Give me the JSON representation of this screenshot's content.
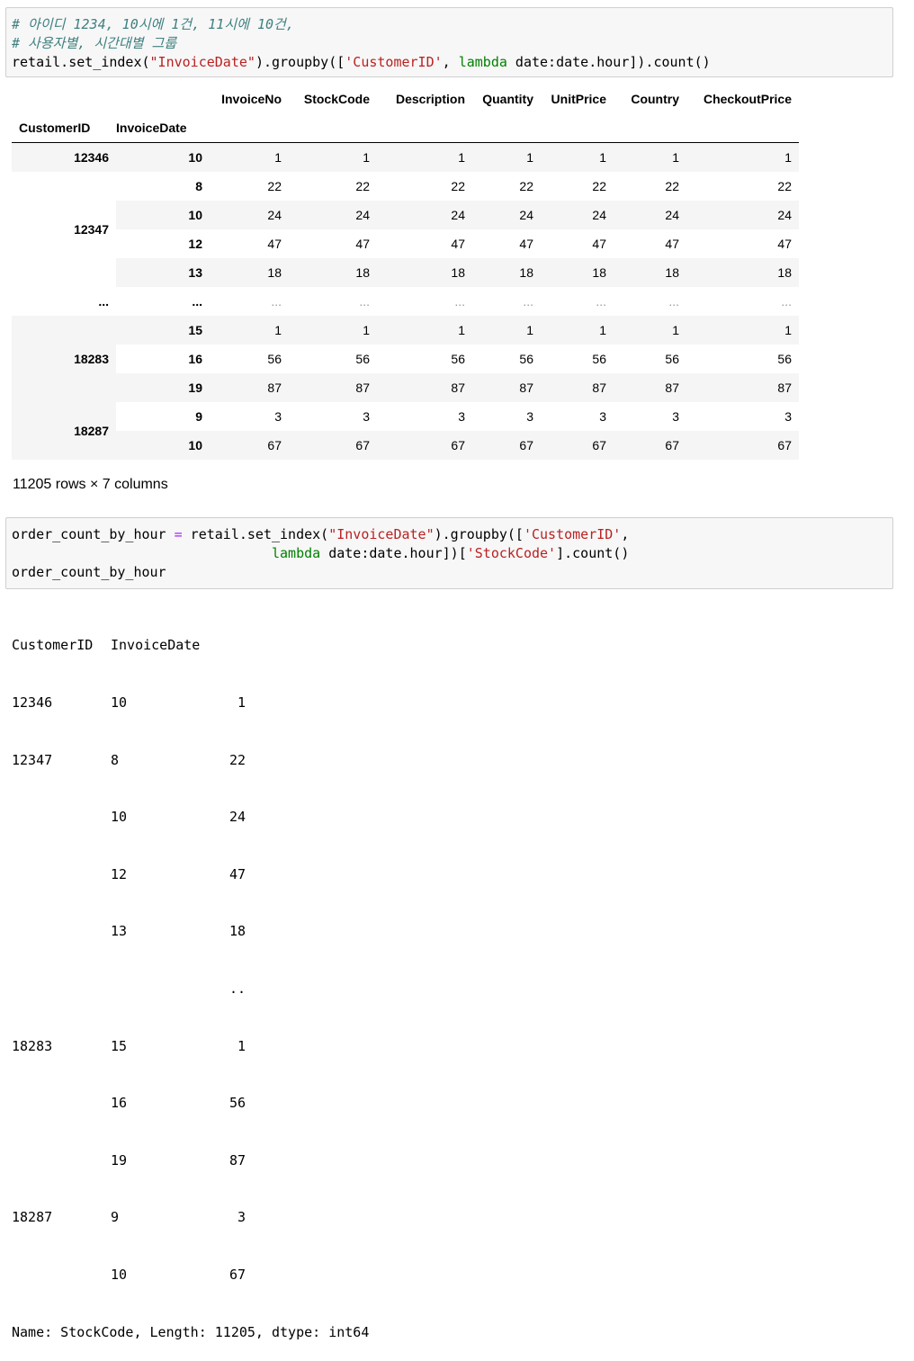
{
  "cell1": {
    "comment1": "# 아이디 1234, 10시에 1건, 11시에 10건,",
    "comment2": "# 사용자별, 시간대별 그룹",
    "code_a": "retail.set_index(",
    "code_str1": "\"InvoiceDate\"",
    "code_b": ").groupby([",
    "code_str2": "'CustomerID'",
    "code_c": ", ",
    "code_kw": "lambda",
    "code_d": " date:date.hour]).count()"
  },
  "dataframe": {
    "columns": [
      "InvoiceNo",
      "StockCode",
      "Description",
      "Quantity",
      "UnitPrice",
      "Country",
      "CheckoutPrice"
    ],
    "index_names": [
      "CustomerID",
      "InvoiceDate"
    ],
    "groups": [
      {
        "customer": "12346",
        "rows": [
          {
            "hour": "10",
            "values": [
              "1",
              "1",
              "1",
              "1",
              "1",
              "1",
              "1"
            ]
          }
        ]
      },
      {
        "customer": "12347",
        "rows": [
          {
            "hour": "8",
            "values": [
              "22",
              "22",
              "22",
              "22",
              "22",
              "22",
              "22"
            ]
          },
          {
            "hour": "10",
            "values": [
              "24",
              "24",
              "24",
              "24",
              "24",
              "24",
              "24"
            ]
          },
          {
            "hour": "12",
            "values": [
              "47",
              "47",
              "47",
              "47",
              "47",
              "47",
              "47"
            ]
          },
          {
            "hour": "13",
            "values": [
              "18",
              "18",
              "18",
              "18",
              "18",
              "18",
              "18"
            ]
          }
        ]
      },
      {
        "customer": "...",
        "rows": [
          {
            "hour": "...",
            "values": [
              "...",
              "...",
              "...",
              "...",
              "...",
              "...",
              "..."
            ]
          }
        ]
      },
      {
        "customer": "18283",
        "rows": [
          {
            "hour": "15",
            "values": [
              "1",
              "1",
              "1",
              "1",
              "1",
              "1",
              "1"
            ]
          },
          {
            "hour": "16",
            "values": [
              "56",
              "56",
              "56",
              "56",
              "56",
              "56",
              "56"
            ]
          },
          {
            "hour": "19",
            "values": [
              "87",
              "87",
              "87",
              "87",
              "87",
              "87",
              "87"
            ]
          }
        ]
      },
      {
        "customer": "18287",
        "rows": [
          {
            "hour": "9",
            "values": [
              "3",
              "3",
              "3",
              "3",
              "3",
              "3",
              "3"
            ]
          },
          {
            "hour": "10",
            "values": [
              "67",
              "67",
              "67",
              "67",
              "67",
              "67",
              "67"
            ]
          }
        ]
      }
    ],
    "shape_note": "11205 rows × 7 columns"
  },
  "cell2": {
    "l1_a": "order_count_by_hour ",
    "l1_op": "=",
    "l1_b": " retail.set_index(",
    "l1_str1": "\"InvoiceDate\"",
    "l1_c": ").groupby([",
    "l1_str2": "'CustomerID'",
    "l1_d": ",",
    "l2_indent": "                                ",
    "l2_kw": "lambda",
    "l2_a": " date:date.hour])[",
    "l2_str": "'StockCode'",
    "l2_b": "].count()",
    "l3": "order_count_by_hour"
  },
  "series_output": {
    "header": [
      "CustomerID",
      "InvoiceDate",
      ""
    ],
    "rows": [
      [
        "12346",
        "10",
        "1"
      ],
      [
        "12347",
        "8",
        "22"
      ],
      [
        "",
        "10",
        "24"
      ],
      [
        "",
        "12",
        "47"
      ],
      [
        "",
        "13",
        "18"
      ],
      [
        "",
        "",
        ".."
      ],
      [
        "18283",
        "15",
        "1"
      ],
      [
        "",
        "16",
        "56"
      ],
      [
        "",
        "19",
        "87"
      ],
      [
        "18287",
        "9",
        "3"
      ],
      [
        "",
        "10",
        "67"
      ]
    ],
    "footer": "Name: StockCode, Length: 11205, dtype: int64"
  }
}
